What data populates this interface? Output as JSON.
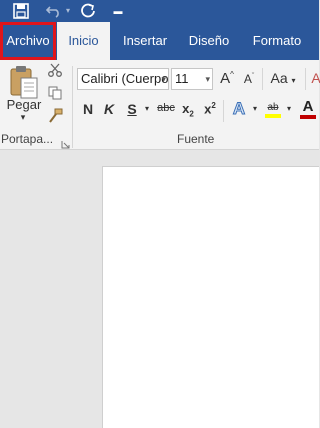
{
  "qat": {
    "save_icon": "save-icon",
    "undo_icon": "undo-icon",
    "redo_icon": "redo-icon",
    "customize_icon": "customize-qat-icon"
  },
  "tabs": {
    "file": "Archivo",
    "home": "Inicio",
    "insert": "Insertar",
    "design": "Diseño",
    "format": "Formato"
  },
  "clipboard": {
    "paste": "Pegar",
    "group_label": "Portapa..."
  },
  "font": {
    "name": "Calibri (Cuerpo",
    "size": "11",
    "group_label": "Fuente",
    "bold": "N",
    "italic": "K",
    "underline": "S",
    "strike": "abc",
    "subscript_base": "x",
    "subscript_mark": "2",
    "superscript_base": "x",
    "superscript_mark": "2",
    "change_case": "Aa",
    "highlight_text": "ab",
    "grow": "A",
    "shrink": "A",
    "font_color": "A",
    "text_effects": "A"
  },
  "colors": {
    "accent": "#2b579a",
    "highlight_box": "#e0151b",
    "highlight_yellow": "#ffff00",
    "font_color_red": "#c00000"
  }
}
